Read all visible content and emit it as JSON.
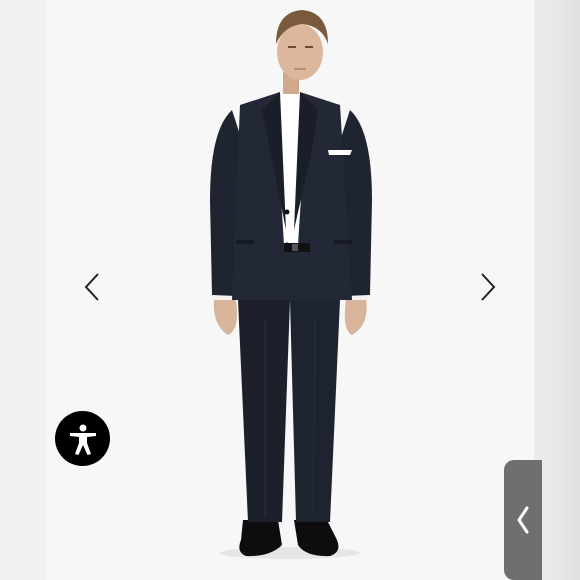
{
  "gallery": {
    "prev_icon": "chevron-left-icon",
    "next_icon": "chevron-right-icon",
    "image_subject": "model-in-dark-navy-suit"
  },
  "accessibility": {
    "icon": "accessibility-person-icon"
  },
  "side_panel": {
    "icon": "chevron-left-icon"
  },
  "colors": {
    "background": "#f7f7f7",
    "suit": "#1e2330",
    "shirt": "#ffffff",
    "accessibility_button": "#000000",
    "side_tab": "#6f6f6f"
  }
}
